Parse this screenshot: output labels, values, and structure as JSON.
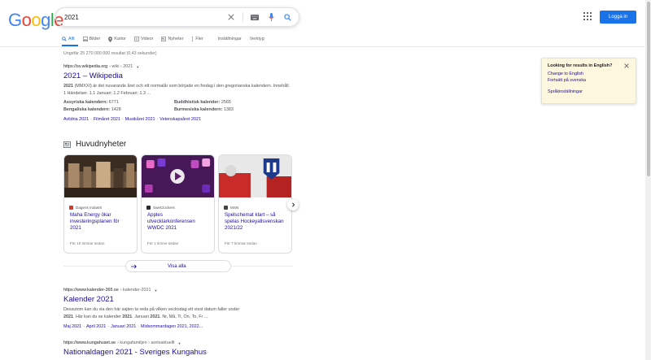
{
  "header": {
    "logo_letters": [
      "G",
      "o",
      "o",
      "g",
      "l",
      "e"
    ],
    "logo_colors": [
      "#4285f4",
      "#ea4335",
      "#fbbc05",
      "#4285f4",
      "#34a853",
      "#ea4335"
    ],
    "search_value": "2021",
    "login_label": "Logga in"
  },
  "tabs": [
    {
      "label": "Allt",
      "icon": "search-icon",
      "active": true
    },
    {
      "label": "Bilder",
      "icon": "image-icon",
      "active": false
    },
    {
      "label": "Kartor",
      "icon": "map-pin-icon",
      "active": false
    },
    {
      "label": "Videor",
      "icon": "video-icon",
      "active": false
    },
    {
      "label": "Nyheter",
      "icon": "news-icon",
      "active": false
    },
    {
      "label": "Fler",
      "icon": "more-icon",
      "active": false
    }
  ],
  "tools": {
    "settings": "Inställningar",
    "tools": "Verktyg"
  },
  "result_stats": "Ungefär 25 270 000 000 resultat (0,43 sekunder)",
  "wiki": {
    "url": "https://sv.wikipedia.org",
    "path": "› wiki › 2021",
    "title": "2021 – Wikipedia",
    "snippet_bold": "2021",
    "snippet_rest_1": " (MMXXI) är det nuvarande året och ett normalår som började en fredag i den gregorianska kalendern. Innehåll. 1 Händelser. 1.1 Januari; 1.2 Februari; 1.3 ...",
    "facts": [
      {
        "label": "Assyriska kalendern:",
        "value": "6771"
      },
      {
        "label": "Buddhistisk kalender:",
        "value": "2565"
      },
      {
        "label": "Bengaliska kalendern:",
        "value": "1428"
      },
      {
        "label": "Burmesiska kalendern:",
        "value": "1383"
      }
    ],
    "sitelinks": [
      "Avlidna 2021",
      "Filmåret 2021",
      "Musikåret 2021",
      "Vetenskapsåret 2021"
    ]
  },
  "news": {
    "heading": "Huvudnyheter",
    "view_all": "Visa alla",
    "cards": [
      {
        "source": "Dagens Industri",
        "title": "Maha Energy ökar investeringsplanen för 2021",
        "age": "För 10 timmar sedan",
        "fav_color": "#d9382c",
        "img_colors": [
          "#6b5440",
          "#3b2c22",
          "#a88a6a"
        ]
      },
      {
        "source": "SweClockers",
        "title": "Apples utvecklarkonferensen WWDC 2021",
        "age": "För 1 timme sedan",
        "fav_color": "#2b2b2b",
        "img_colors": [
          "#5b1f6b",
          "#c04bc0",
          "#2a0f3a"
        ]
      },
      {
        "source": "MSN",
        "title": "Spelschemat klart – så spelas Hockeyallsvenskan 2021/22",
        "age": "För 7 timmar sedan",
        "fav_color": "#444444",
        "img_colors": [
          "#c92a2a",
          "#e8e8e8",
          "#1e3a8a"
        ]
      }
    ]
  },
  "result2": {
    "url": "https://www.kalender-365.se",
    "path": "› kalender-2021",
    "title": "Kalender 2021",
    "snippet_line1": "Dessutom kan du via den här sajten ta reda på vilken veckodag ett visst datum faller under",
    "snippet_line2_a": "2021",
    "snippet_line2_b": ". Här kan du se kalender ",
    "snippet_line2_c": "2021",
    "snippet_line2_d": ". Januari ",
    "snippet_line2_e": "2021",
    "snippet_line2_f": ". Nr, Må, Ti, On, To, Fr ...",
    "sitelinks": [
      "Maj 2021",
      "April 2021",
      "Januari 2021",
      "Midsommardagen 2021, 2022..."
    ]
  },
  "result3": {
    "url": "https://www.kungahuset.se",
    "path": "› kungafamiljen › aretsaktuellt",
    "title": "Nationaldagen 2021 - Sveriges Kungahus"
  },
  "kbox": {
    "question": "Looking for results in English?",
    "change": "Change to English",
    "continue": "Fortsätt på svenska",
    "settings": "Språkinställningar"
  }
}
